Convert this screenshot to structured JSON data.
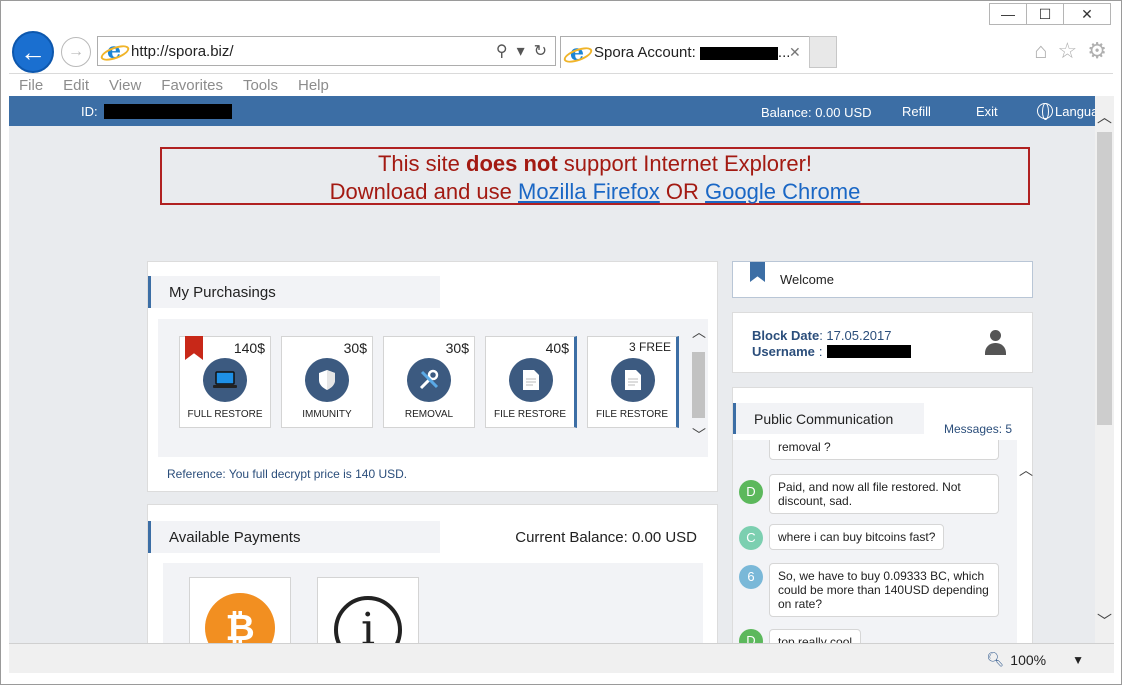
{
  "window": {
    "minimize": "—",
    "maximize": "☐",
    "close": "✕"
  },
  "address": {
    "url": "http://spora.biz/"
  },
  "tab": {
    "title": "Spora Account: ",
    "suffix": "..."
  },
  "menu": [
    "File",
    "Edit",
    "View",
    "Favorites",
    "Tools",
    "Help"
  ],
  "topbar": {
    "id_label": "ID:",
    "balance": "Balance: 0.00 USD",
    "refill": "Refill",
    "exit": "Exit",
    "language": "Langua"
  },
  "warning": {
    "line1_pre": "This site ",
    "line1_bold": "does not",
    "line1_post": " support Internet Explorer!",
    "line2_pre": "Download and use ",
    "firefox": "Mozilla Firefox",
    "or": " OR ",
    "chrome": "Google Chrome"
  },
  "purchasings": {
    "title": "My Purchasings",
    "products": [
      {
        "price": "140$",
        "label": "FULL RESTORE",
        "icon": "laptop-icon"
      },
      {
        "price": "30$",
        "label": "IMMUNITY",
        "icon": "shield-icon"
      },
      {
        "price": "30$",
        "label": "REMOVAL",
        "icon": "tools-icon"
      },
      {
        "price": "40$",
        "label": "FILE RESTORE",
        "icon": "document-icon"
      },
      {
        "price": "3 FREE",
        "label": "FILE RESTORE",
        "icon": "document-icon"
      }
    ],
    "reference": "Reference: You full decrypt price is 140 USD."
  },
  "payments": {
    "title": "Available Payments",
    "current_balance": "Current Balance: 0.00 USD",
    "methods": [
      {
        "icon": "bitcoin-icon",
        "symbol": "₿"
      },
      {
        "icon": "info-icon",
        "symbol": "i"
      }
    ]
  },
  "welcome": {
    "text": "Welcome"
  },
  "account": {
    "block_date_label": "Block Date",
    "block_date_value": ": 17.05.2017",
    "username_label": "Username",
    "username_sep": ":"
  },
  "communication": {
    "title": "Public Communication",
    "messages": "Messages: 5",
    "items": [
      {
        "avatar": "",
        "color": "#ffffff",
        "text": "removal ?"
      },
      {
        "avatar": "D",
        "color": "#5cb85c",
        "text": "Paid, and now all file restored. Not discount, sad."
      },
      {
        "avatar": "C",
        "color": "#7ccfb0",
        "text": "where i can buy bitcoins fast?"
      },
      {
        "avatar": "6",
        "color": "#7ab8d8",
        "text": "So, we have to buy 0.09333 BC, which could be more than 140USD depending on rate?"
      },
      {
        "avatar": "D",
        "color": "#5cb85c",
        "text": "top really cool"
      }
    ]
  },
  "status": {
    "zoom": "100%"
  },
  "colors": {
    "brand_blue": "#3c6ea5",
    "warning_red": "#a31a12",
    "link_blue": "#1a67c5",
    "bitcoin_orange": "#f28f21"
  }
}
